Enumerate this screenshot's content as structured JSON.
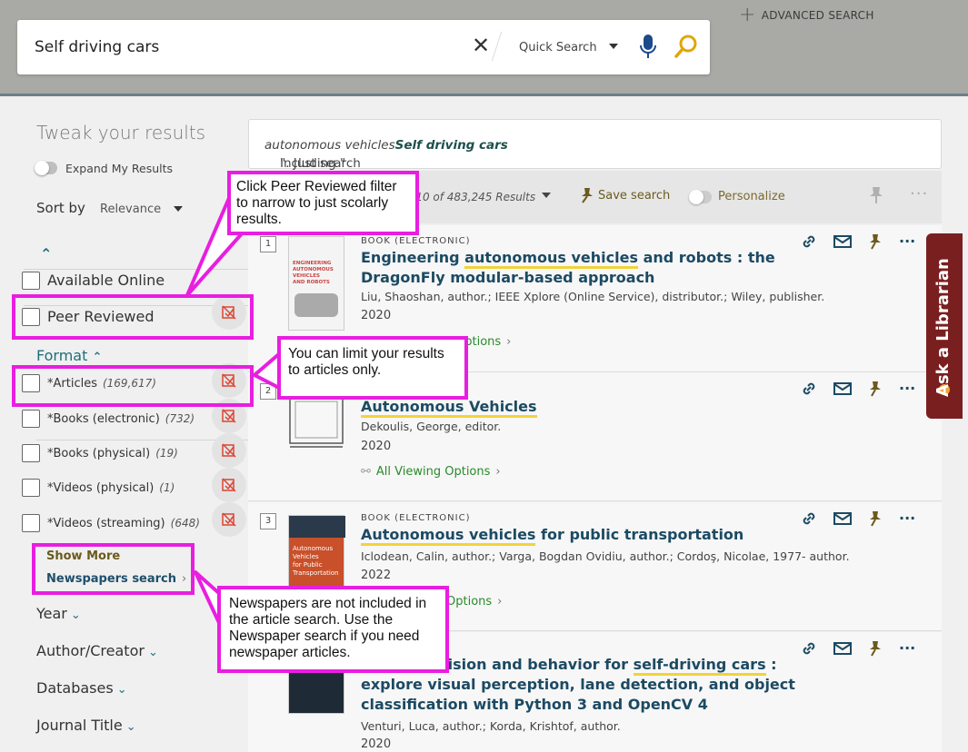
{
  "header": {
    "advanced_search": "ADVANCED SEARCH",
    "search_value": "Self driving cars",
    "scope": "Quick Search"
  },
  "sidebar": {
    "title": "Tweak your results",
    "expand_label": "Expand My Results",
    "sort_label": "Sort by",
    "sort_value": "Relevance",
    "availability": [
      {
        "label": "Available Online"
      },
      {
        "label": "Peer Reviewed"
      }
    ],
    "format_head": "Format",
    "formats": [
      {
        "label": "*Articles",
        "count": "(169,617)"
      },
      {
        "label": "*Books (electronic)",
        "count": "(732)"
      },
      {
        "label": "*Books (physical)",
        "count": "(19)"
      },
      {
        "label": "*Videos (physical)",
        "count": "(1)"
      },
      {
        "label": "*Videos (streaming)",
        "count": "(648)"
      }
    ],
    "show_more": "Show More",
    "newspapers_search": "Newspapers search",
    "sections": [
      "Year",
      "Author/Creator",
      "Databases",
      "Journal Title"
    ]
  },
  "results": {
    "including_prefix": "Including \"",
    "including_term": "autonomous vehicles",
    "including_middle": "\". Just search ",
    "including_original": "Self driving cars",
    "count_text": "-10 of 483,245 Results",
    "save_search": "Save search",
    "personalize": "Personalize",
    "records": [
      {
        "num": "1",
        "type": "BOOK (ELECTRONIC)",
        "title_a": "Engineering ",
        "title_hl": "autonomous vehicles",
        "title_b": " and robots : the DragonFly modular-based approach",
        "author": "Liu, Shaoshan, author.; IEEE Xplore (Online Service), distributor.; Wiley, publisher.",
        "year": "2020",
        "viewing": "Options",
        "thumb_lines": [
          "ENGINEERING",
          "AUTONOMOUS",
          "VEHICLES",
          "AND ROBOTS"
        ]
      },
      {
        "num": "2",
        "type": "",
        "title_a": "",
        "title_hl": "Autonomous Vehicles",
        "title_b": "",
        "author": "Dekoulis, George, editor.",
        "year": "2020",
        "viewing": "All Viewing Options",
        "thumb_lines": []
      },
      {
        "num": "3",
        "type": "BOOK (ELECTRONIC)",
        "title_a": "",
        "title_hl": "Autonomous vehicles",
        "title_b": " for public transportation",
        "author": "Iclodean, Calin, author.; Varga, Bogdan Ovidiu, author.; Cordoş, Nicolae, 1977- author.",
        "year": "2022",
        "viewing": "Options",
        "thumb_lines": [
          "Autonomous",
          "Vehicles",
          "for Public",
          "Transportation"
        ]
      },
      {
        "num": "4",
        "type": "C)",
        "title_a": "...nds-on vision and behavior for ",
        "title_hl": "self-driving cars",
        "title_b": " : explore visual perception, lane detection, and object classification with Python 3 and OpenCV 4",
        "author": "Venturi, Luca, author.; Korda, Krishtof, author.",
        "year": "2020",
        "viewing": "",
        "thumb_lines": []
      }
    ]
  },
  "ask_librarian": "Ask a Librarian",
  "callouts": {
    "peer": "Click Peer Reviewed filter to narrow to just scolarly results.",
    "articles": "You can limit your results to articles only.",
    "newspapers": "Newspapers are not included in the article search. Use the Newspaper search if you need newspaper articles."
  },
  "colors": {
    "header_bg": "#a9a9a5",
    "callout_border": "#e81ee0",
    "link_title": "#1c4a63",
    "highlight": "#f2d33a",
    "librarian_tab": "#7a1f1f"
  }
}
